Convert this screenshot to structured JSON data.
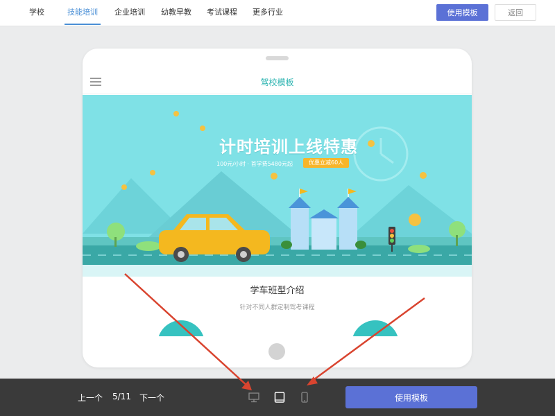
{
  "top_nav": {
    "tabs": [
      {
        "label": "学校",
        "active": false
      },
      {
        "label": "技能培训",
        "active": true
      },
      {
        "label": "企业培训",
        "active": false
      },
      {
        "label": "幼教早教",
        "active": false
      },
      {
        "label": "考试课程",
        "active": false
      },
      {
        "label": "更多行业",
        "active": false
      }
    ],
    "use_template_label": "使用模板",
    "back_label": "返回"
  },
  "preview": {
    "app_title": "驾校模板",
    "banner": {
      "title": "计时培训上线特惠",
      "subtitle": "100元/小时 · 首学费5480元起",
      "badge": "优惠立减60人"
    },
    "section_title": "学车班型介绍",
    "section_subtitle": "针对不同人群定制驾考课程"
  },
  "bottom_bar": {
    "prev_label": "上一个",
    "page_indicator": "5/11",
    "next_label": "下一个",
    "devices": [
      "desktop-icon",
      "tablet-icon",
      "phone-icon"
    ],
    "selected_device": "tablet",
    "use_template_label": "使用模板"
  },
  "colors": {
    "accent_blue": "#5b71d6",
    "active_tab": "#4a8fd6",
    "teal": "#2ab3b0",
    "banner_bg": "#7fe1e6",
    "bottom_bar": "#3a3a3a",
    "annotation_arrow": "#d9442f"
  }
}
